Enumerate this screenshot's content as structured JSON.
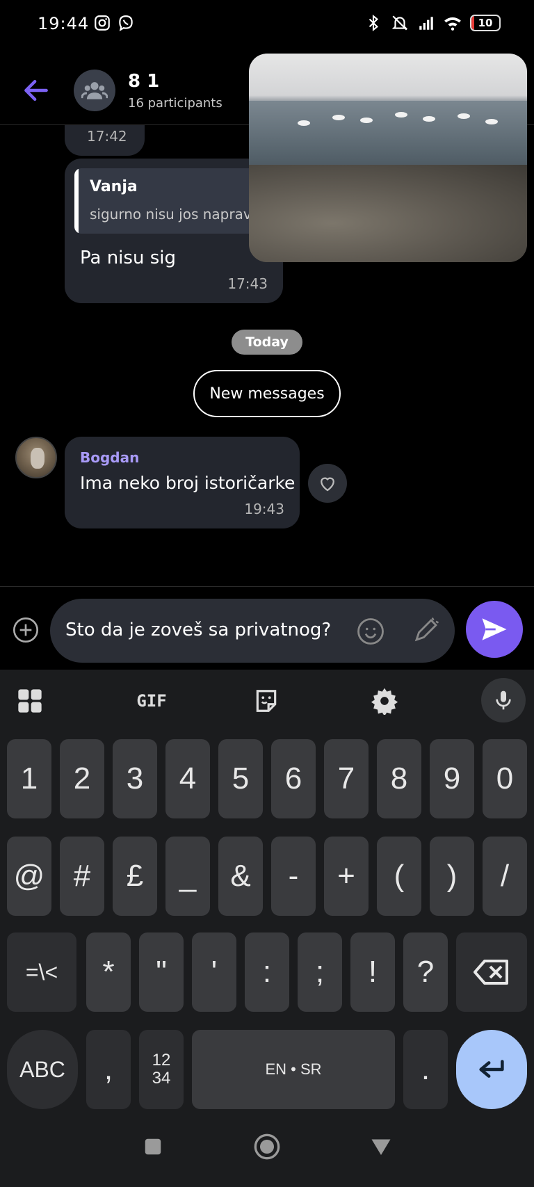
{
  "status_bar": {
    "time": "19:44",
    "battery": "10",
    "battery_color": "#e53935",
    "icons_left": [
      "instagram-icon",
      "viber-icon"
    ],
    "icons_right": [
      "bluetooth-icon",
      "mute-bell-icon",
      "signal-icon",
      "wifi-icon",
      "battery-icon"
    ]
  },
  "header": {
    "title": "8 1",
    "subtitle": "16 participants"
  },
  "messages": {
    "partial_time": "17:42",
    "reply": {
      "quote_name": "Vanja",
      "quote_text": "sigurno nisu jos napravili",
      "text": "Pa nisu sig",
      "time": "17:43"
    },
    "day_divider": "Today",
    "new_messages": "New messages",
    "incoming": {
      "sender": "Bogdan",
      "text": "Ima neko broj istoričarke",
      "time": "19:43"
    }
  },
  "composer": {
    "draft": "Sto da je zoveš sa privatnog?",
    "accent": "#7a5af0"
  },
  "keyboard": {
    "toolbar": {
      "gif": "GIF"
    },
    "row1": [
      "1",
      "2",
      "3",
      "4",
      "5",
      "6",
      "7",
      "8",
      "9",
      "0"
    ],
    "row2": [
      "@",
      "#",
      "£",
      "_",
      "&",
      "-",
      "+",
      "(",
      ")",
      "/"
    ],
    "row3": [
      "=\\<",
      "*",
      "\"",
      "'",
      ":",
      ";",
      "!",
      "?"
    ],
    "row4": {
      "abc": "ABC",
      "comma": ",",
      "numpad": "12\n34",
      "space": "EN • SR",
      "period": "."
    },
    "enter_color": "#a8c7fa"
  }
}
